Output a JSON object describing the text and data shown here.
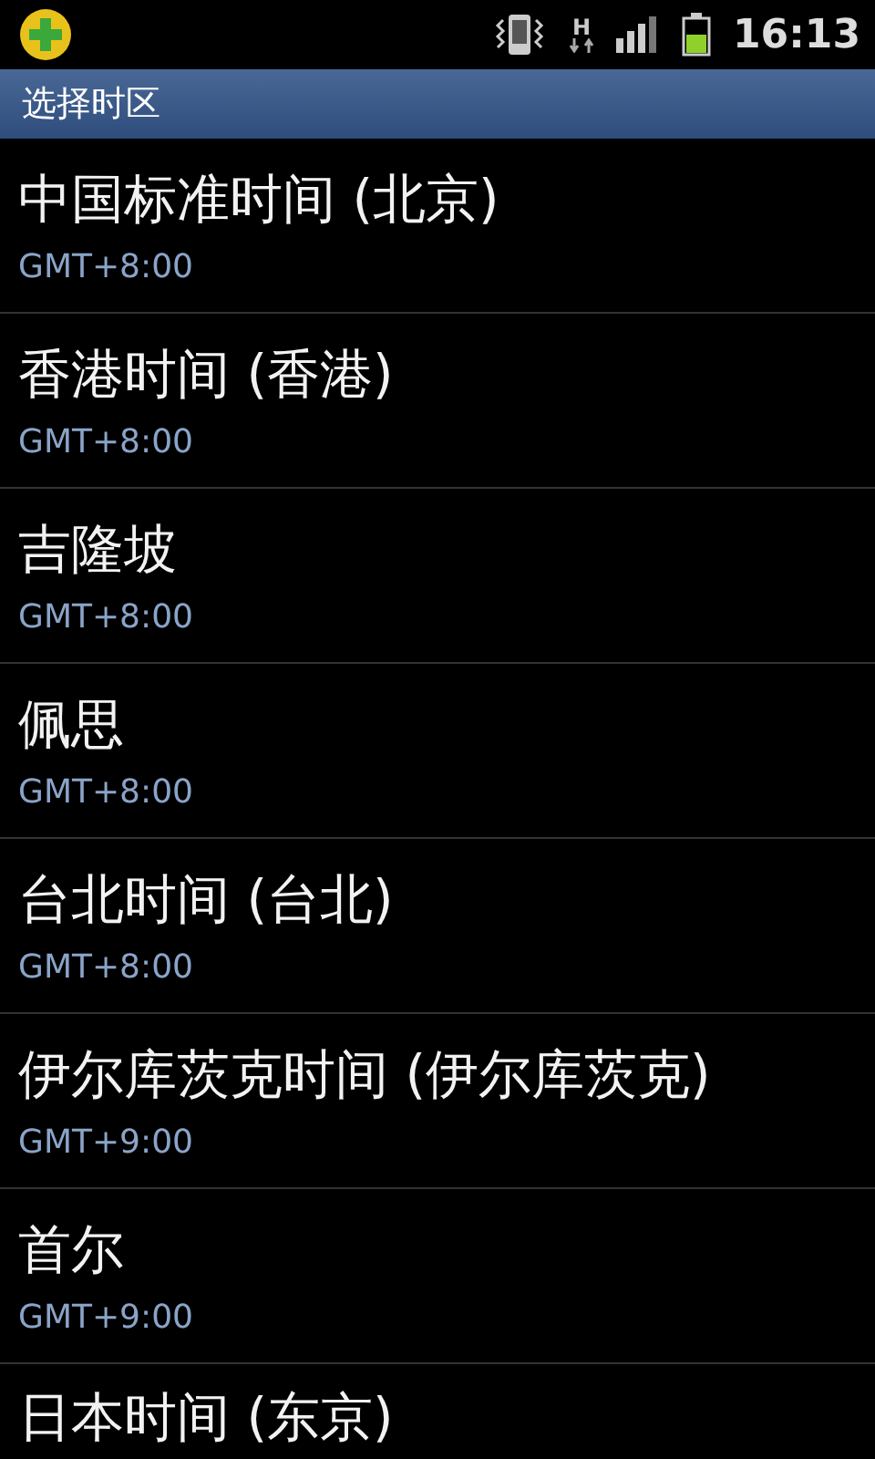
{
  "status_bar": {
    "time": "16:13",
    "network_label": "H"
  },
  "title_bar": {
    "title": "选择时区"
  },
  "timezones": [
    {
      "name": "中国标准时间 (北京)",
      "offset": "GMT+8:00"
    },
    {
      "name": "香港时间 (香港)",
      "offset": "GMT+8:00"
    },
    {
      "name": "吉隆坡",
      "offset": "GMT+8:00"
    },
    {
      "name": "佩思",
      "offset": "GMT+8:00"
    },
    {
      "name": "台北时间 (台北)",
      "offset": "GMT+8:00"
    },
    {
      "name": "伊尔库茨克时间 (伊尔库茨克)",
      "offset": "GMT+9:00"
    },
    {
      "name": "首尔",
      "offset": "GMT+9:00"
    },
    {
      "name": "日本时间 (东京)"
    }
  ]
}
